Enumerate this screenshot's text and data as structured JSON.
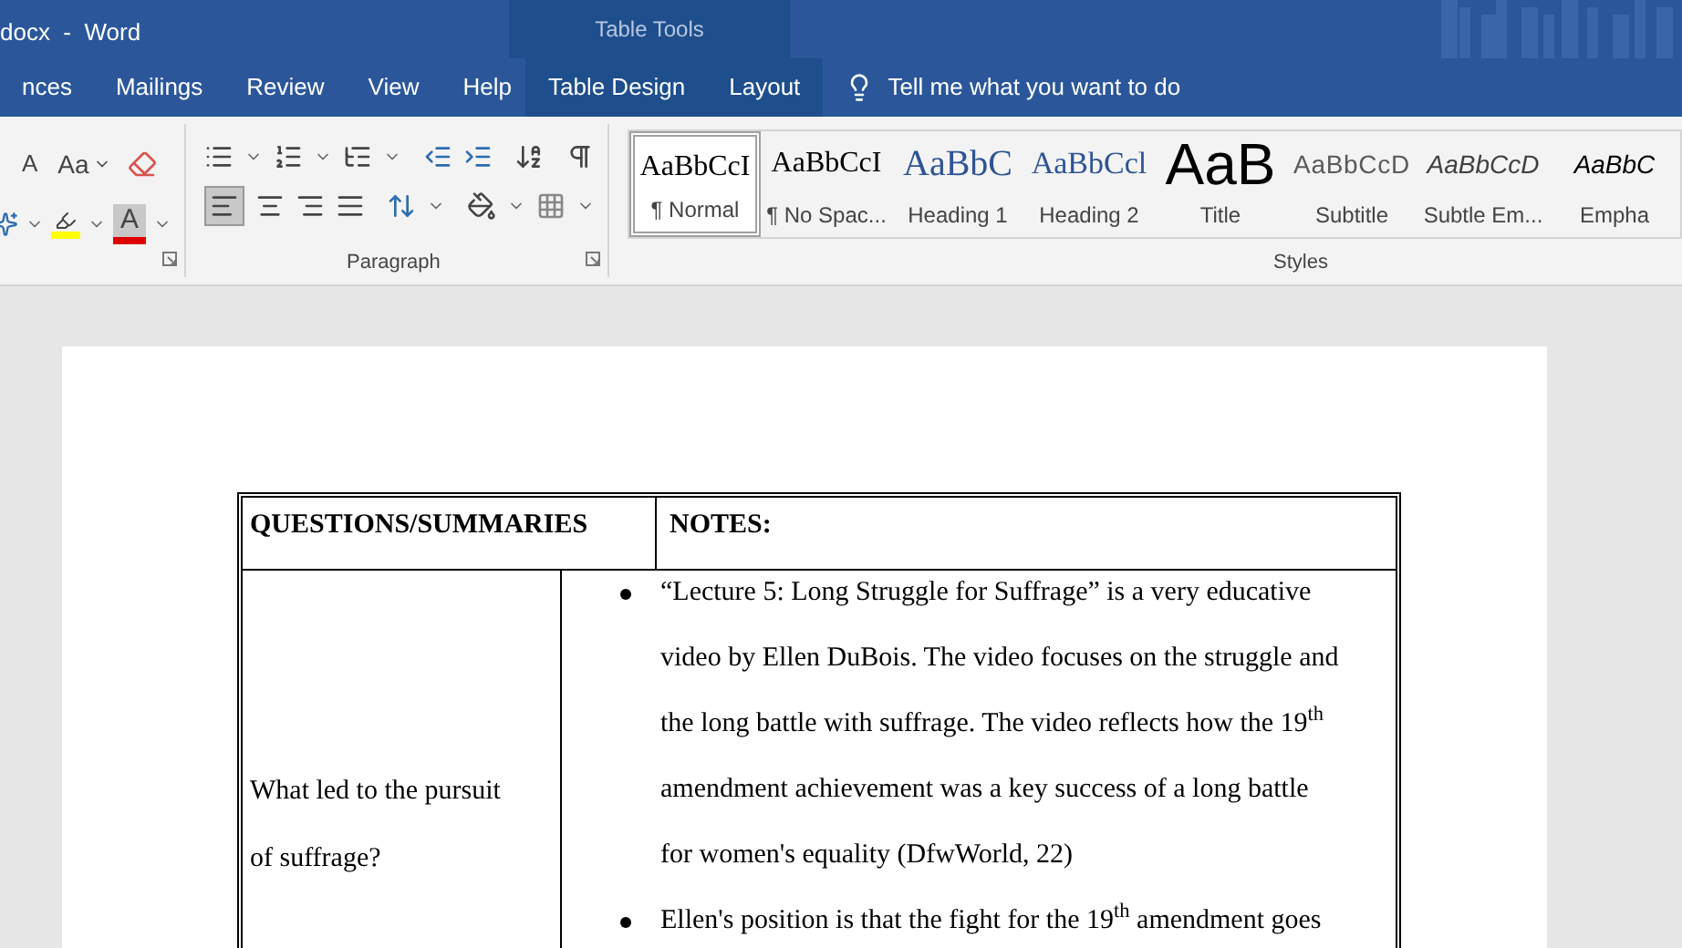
{
  "window": {
    "title": "docx  -  Word",
    "context_group": "Table Tools"
  },
  "tabs": [
    {
      "label": "nces",
      "selected": false,
      "contextual": false
    },
    {
      "label": "Mailings",
      "selected": false,
      "contextual": false
    },
    {
      "label": "Review",
      "selected": false,
      "contextual": false
    },
    {
      "label": "View",
      "selected": false,
      "contextual": false
    },
    {
      "label": "Help",
      "selected": false,
      "contextual": false
    },
    {
      "label": "Table Design",
      "selected": false,
      "contextual": true
    },
    {
      "label": "Layout",
      "selected": false,
      "contextual": true
    }
  ],
  "tell_me": {
    "placeholder": "Tell me what you want to do"
  },
  "font_group": {
    "grow_font": "A",
    "change_case": "Aa",
    "font_color": "A"
  },
  "paragraph_group": {
    "label": "Paragraph",
    "align_left_selected": true
  },
  "styles_group": {
    "label": "Styles",
    "items": [
      {
        "preview": "AaBbCcI",
        "name": "¶ Normal",
        "kind": "normal",
        "selected": true
      },
      {
        "preview": "AaBbCcI",
        "name": "¶ No Spac...",
        "kind": "normal",
        "selected": false
      },
      {
        "preview": "AaBbC",
        "name": "Heading 1",
        "kind": "heading1",
        "selected": false
      },
      {
        "preview": "AaBbCcl",
        "name": "Heading 2",
        "kind": "heading2",
        "selected": false
      },
      {
        "preview": "AaB",
        "name": "Title",
        "kind": "title",
        "selected": false
      },
      {
        "preview": "AaBbCcD",
        "name": "Subtitle",
        "kind": "subtitle",
        "selected": false
      },
      {
        "preview": "AaBbCcD",
        "name": "Subtle Em...",
        "kind": "emphasis",
        "selected": false
      },
      {
        "preview": "AaBbC",
        "name": "Empha",
        "kind": "emphasis_strong",
        "selected": false
      }
    ]
  },
  "document": {
    "table": {
      "columns": [
        "QUESTIONS/SUMMARIES",
        "NOTES:"
      ],
      "rows": [
        {
          "question": [
            "What led to the pursuit",
            "of suffrage?"
          ],
          "notes": [
            [
              "“Lecture 5: Long Struggle for Suffrage” is a very educative",
              "video by Ellen DuBois. The video focuses on the struggle and",
              "the long battle with suffrage. The video reflects how the 19$^{th}$",
              "amendment achievement was a key success of a long battle",
              "for women's equality (DfwWorld, 22)"
            ],
            [
              "Ellen's position is that the fight for the 19$^{th}$ amendment goes"
            ]
          ]
        }
      ]
    }
  }
}
